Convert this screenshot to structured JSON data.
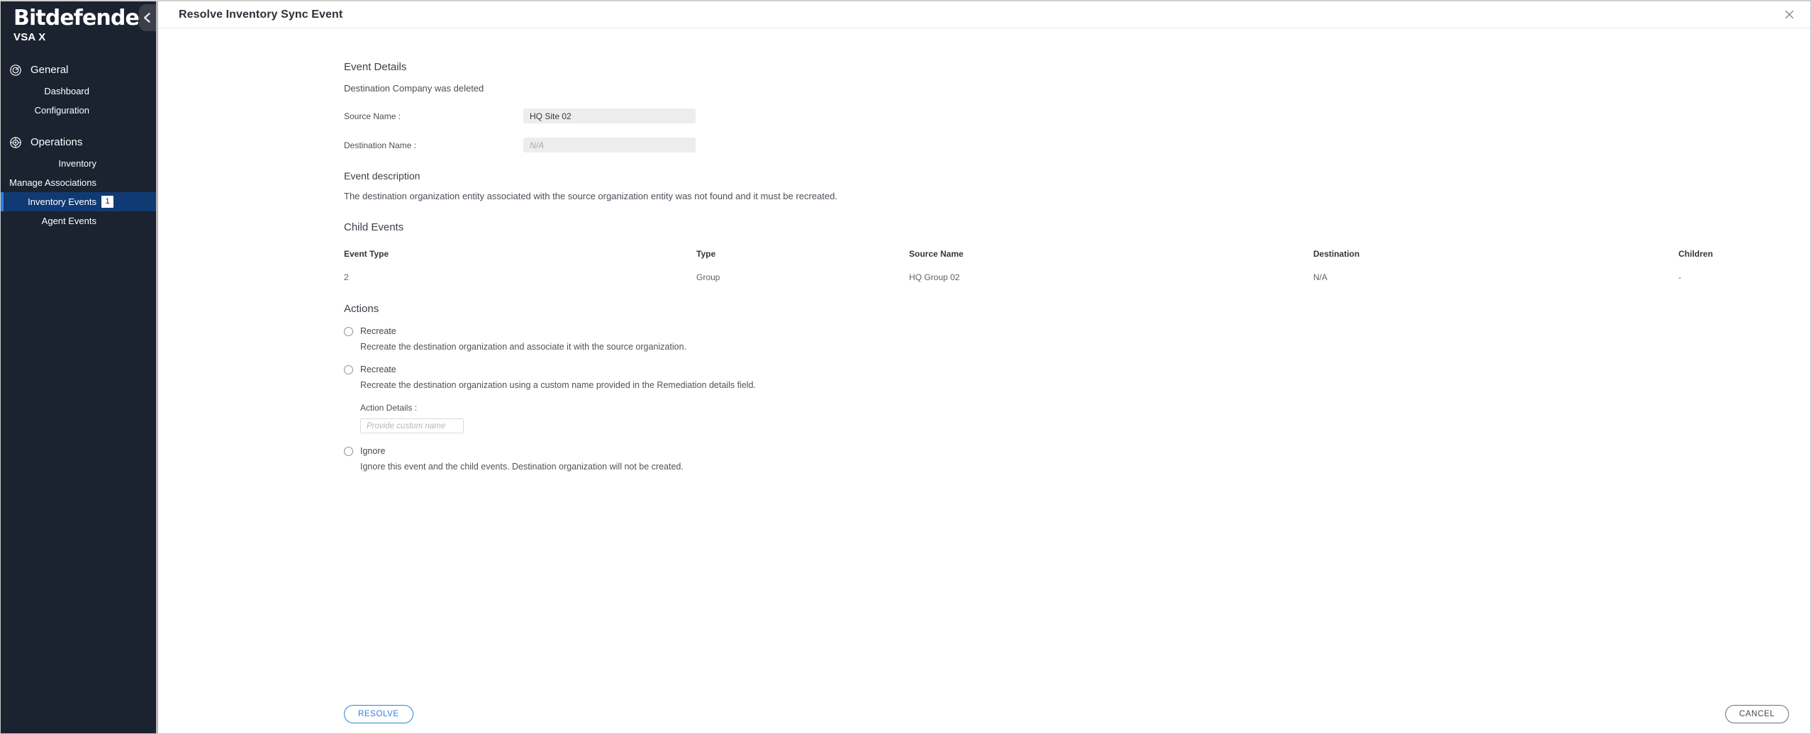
{
  "sidebar": {
    "brand": "Bitdefender",
    "brand_mark": "®",
    "product": "VSA X",
    "collapse_icon": "chevron-left-icon",
    "groups": [
      {
        "label": "General",
        "icon": "target-circle-icon",
        "items": [
          {
            "label": "Dashboard",
            "active": false,
            "badge": ""
          },
          {
            "label": "Configuration",
            "active": false,
            "badge": ""
          }
        ]
      },
      {
        "label": "Operations",
        "icon": "gear-target-icon",
        "items": [
          {
            "label": "Inventory",
            "active": false,
            "badge": ""
          },
          {
            "label": "Manage Associations",
            "active": false,
            "badge": ""
          },
          {
            "label": "Inventory Events",
            "active": true,
            "badge": "1"
          },
          {
            "label": "Agent Events",
            "active": false,
            "badge": ""
          }
        ]
      }
    ]
  },
  "topbar": {
    "title": "Resolve Inventory Sync Event",
    "close_icon": "close-icon"
  },
  "event_details": {
    "heading": "Event Details",
    "summary": "Destination Company was deleted",
    "fields": [
      {
        "label": "Source Name :",
        "value": "HQ Site 02",
        "placeholder": ""
      },
      {
        "label": "Destination Name :",
        "value": "",
        "placeholder": "N/A"
      }
    ]
  },
  "event_description": {
    "heading": "Event description",
    "body": "The destination organization entity associated with the source organization entity was not found and it must be recreated."
  },
  "child_events": {
    "heading": "Child Events",
    "columns": [
      "Event Type",
      "Type",
      "Source Name",
      "Destination",
      "Children"
    ],
    "rows": [
      {
        "event_type": "2",
        "type": "Group",
        "source_name": "HQ Group 02",
        "destination": "N/A",
        "children": "-"
      }
    ]
  },
  "actions": {
    "heading": "Actions",
    "options": [
      {
        "label": "Recreate",
        "description": "Recreate the destination organization and associate it with the source organization.",
        "selected": false
      },
      {
        "label": "Recreate",
        "description": "Recreate the destination organization using a custom name provided in the Remediation details field.",
        "selected": false
      },
      {
        "label": "Ignore",
        "description": "Ignore this event and the child events. Destination organization will not be created.",
        "selected": false
      }
    ],
    "action_details": {
      "label": "Action Details :",
      "value": "",
      "placeholder": "Provide custom name"
    }
  },
  "footer": {
    "resolve_label": "RESOLVE",
    "cancel_label": "CANCEL"
  },
  "colors": {
    "sidebar_bg": "#1b2230",
    "active_item_bg": "#103a73",
    "accent_blue": "#2f7fe0",
    "text_dark": "#3b4049",
    "input_bg": "#ededed"
  }
}
